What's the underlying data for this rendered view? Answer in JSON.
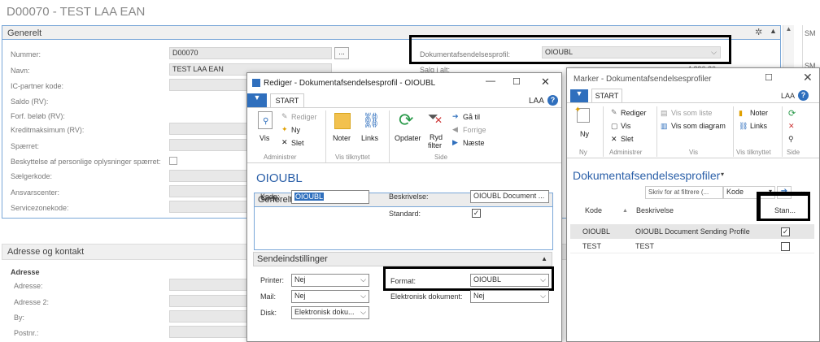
{
  "bg": {
    "title": "D00070 - TEST LAA EAN",
    "section_generelt": "Generelt",
    "labels": {
      "nummer": "Nummer:",
      "navn": "Navn:",
      "ic": "IC-partner kode:",
      "saldo": "Saldo (RV):",
      "forf": "Forf. beløb (RV):",
      "kredit": "Kreditmaksimum (RV):",
      "sperret": "Spærret:",
      "beskyt": "Beskyttelse af personlige oplysninger spærret:",
      "saelger": "Sælgerkode:",
      "ansvar": "Ansvarscenter:",
      "service": "Servicezonekode:",
      "dokprofil": "Dokumentafsendelsesprofil:",
      "salg": "Salg i alt:"
    },
    "values": {
      "nummer": "D00070",
      "navn": "TEST LAA EAN",
      "dokprofil": "OIOUBL",
      "salg": "4.290,20"
    },
    "ellipsis": "...",
    "section_adresse": "Adresse og kontakt",
    "adresse_hdr": "Adresse",
    "adr_labels": {
      "adresse": "Adresse:",
      "adresse2": "Adresse 2:",
      "by": "By:",
      "postnr": "Postnr.:"
    },
    "right_clip": "SM",
    "right_clip2": "SM"
  },
  "win1": {
    "title": "Rediger - Dokumentafsendelsesprofil - OIOUBL",
    "tab": "START",
    "user": "LAA",
    "ribbon": {
      "vis": "Vis",
      "rediger": "Rediger",
      "ny": "Ny",
      "slet": "Slet",
      "noter": "Noter",
      "links": "Links",
      "opdater": "Opdater",
      "ryd1": "Ryd",
      "ryd2": "filter",
      "gaa": "Gå til",
      "forrige": "Forrige",
      "naeste": "Næste",
      "grp_admin": "Administrer",
      "grp_vis": "Vis tilknyttet",
      "grp_side": "Side"
    },
    "heading": "OIOUBL",
    "sec_generelt": "Generelt",
    "kode_lbl": "Kode:",
    "kode_val": "OIOUBL",
    "beskr_lbl": "Beskrivelse:",
    "beskr_val": "OIOUBL Document ...",
    "standard_lbl": "Standard:",
    "standard_check": "✓",
    "sec_send": "Sendeindstillinger",
    "printer_lbl": "Printer:",
    "printer_val": "Nej",
    "mail_lbl": "Mail:",
    "mail_val": "Nej",
    "disk_lbl": "Disk:",
    "disk_val": "Elektronisk doku...",
    "format_lbl": "Format:",
    "format_val": "OIOUBL",
    "eldok_lbl": "Elektronisk dokument:",
    "eldok_val": "Nej"
  },
  "win2": {
    "title": "Marker - Dokumentafsendelsesprofiler",
    "tab": "START",
    "user": "LAA",
    "ribbon": {
      "ny": "Ny",
      "rediger": "Rediger",
      "vis": "Vis",
      "slet": "Slet",
      "vis_liste": "Vis som liste",
      "vis_diagram": "Vis som diagram",
      "noter": "Noter",
      "links": "Links",
      "grp_ny": "Ny",
      "grp_admin": "Administrer",
      "grp_vis": "Vis",
      "grp_vistil": "Vis tilknyttet",
      "grp_side": "Side"
    },
    "heading": "Dokumentafsendelsesprofiler",
    "filter_placeholder": "Skriv for at filtrere (...",
    "filter_field": "Kode",
    "columns": {
      "kode": "Kode",
      "beskrivelse": "Beskrivelse",
      "standard": "Stan..."
    },
    "rows": [
      {
        "kode": "OIOUBL",
        "beskrivelse": "OIOUBL Document Sending Profile",
        "checked": "✓"
      },
      {
        "kode": "TEST",
        "beskrivelse": "TEST",
        "checked": ""
      }
    ]
  }
}
